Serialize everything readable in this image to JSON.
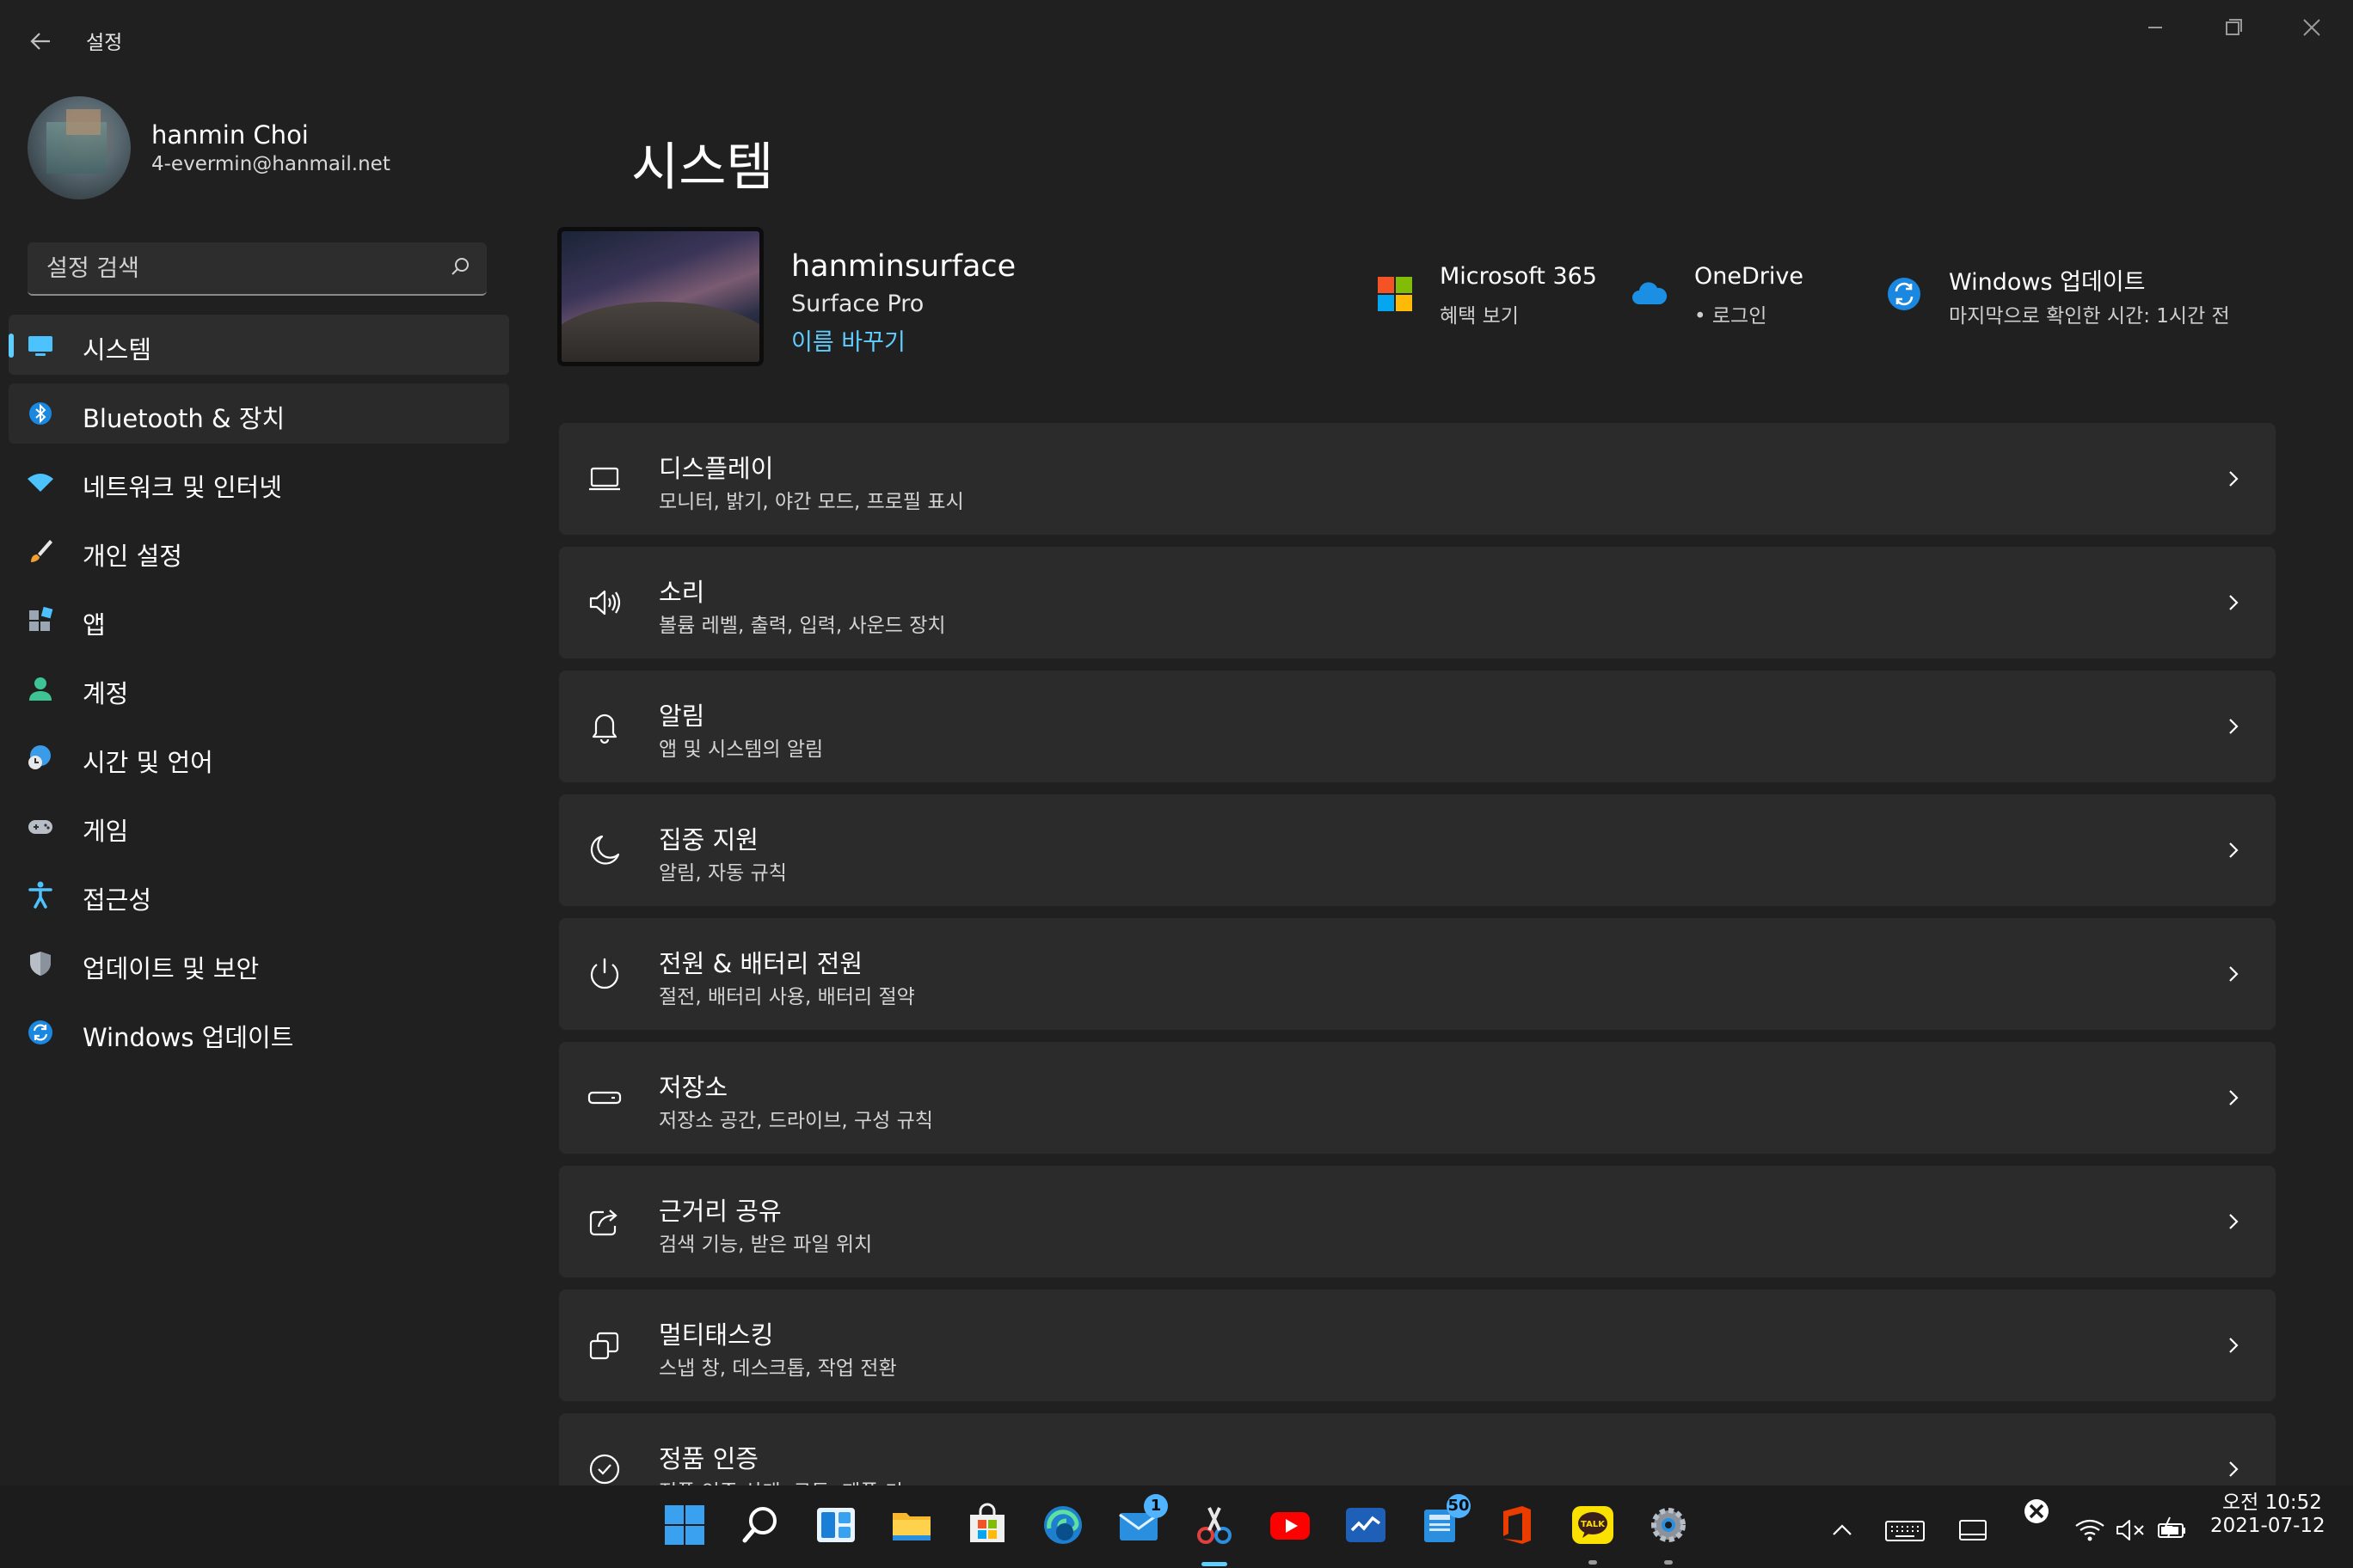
{
  "window": {
    "app_title": "설정",
    "back_icon": "back-arrow-icon",
    "controls": [
      "minimize-icon",
      "restore-icon",
      "close-icon"
    ]
  },
  "profile": {
    "name": "hanmin Choi",
    "email": "4-evermin@hanmail.net"
  },
  "search": {
    "placeholder": "설정 검색"
  },
  "sidebar": {
    "items": [
      {
        "label": "시스템",
        "icon": "monitor-icon",
        "active": true
      },
      {
        "label": "Bluetooth & 장치",
        "icon": "bluetooth-icon"
      },
      {
        "label": "네트워크 및 인터넷",
        "icon": "wifi-icon"
      },
      {
        "label": "개인 설정",
        "icon": "brush-icon"
      },
      {
        "label": "앱",
        "icon": "apps-icon"
      },
      {
        "label": "계정",
        "icon": "account-icon"
      },
      {
        "label": "시간 및 언어",
        "icon": "globe-clock-icon"
      },
      {
        "label": "게임",
        "icon": "gamepad-icon"
      },
      {
        "label": "접근성",
        "icon": "accessibility-icon"
      },
      {
        "label": "업데이트 및 보안",
        "icon": "shield-icon"
      },
      {
        "label": "Windows 업데이트",
        "icon": "windows-update-icon"
      }
    ]
  },
  "main": {
    "title": "시스템",
    "device": {
      "name": "hanminsurface",
      "model": "Surface Pro",
      "rename": "이름 바꾸기"
    },
    "quick": [
      {
        "title": "Microsoft 365",
        "sub": "혜택 보기",
        "icon": "microsoft-logo-icon"
      },
      {
        "title": "OneDrive",
        "sub": "• 로그인",
        "icon": "onedrive-cloud-icon"
      },
      {
        "title": "Windows 업데이트",
        "sub": "마지막으로 확인한 시간: 1시간 전",
        "icon": "windows-update-icon"
      }
    ],
    "cards": [
      {
        "title": "디스플레이",
        "sub": "모니터, 밝기, 야간 모드, 프로필 표시",
        "icon": "display-icon"
      },
      {
        "title": "소리",
        "sub": "볼륨 레벨, 출력, 입력, 사운드 장치",
        "icon": "speaker-icon"
      },
      {
        "title": "알림",
        "sub": "앱 및 시스템의 알림",
        "icon": "bell-icon"
      },
      {
        "title": "집중 지원",
        "sub": "알림, 자동 규칙",
        "icon": "moon-icon"
      },
      {
        "title": "전원 & 배터리 전원",
        "sub": "절전, 배터리 사용, 배터리 절약",
        "icon": "power-icon"
      },
      {
        "title": "저장소",
        "sub": "저장소 공간, 드라이브, 구성 규칙",
        "icon": "storage-icon"
      },
      {
        "title": "근거리 공유",
        "sub": "검색 기능, 받은 파일 위치",
        "icon": "share-icon"
      },
      {
        "title": "멀티태스킹",
        "sub": "스냅 창, 데스크톱, 작업 전환",
        "icon": "multitask-icon"
      },
      {
        "title": "정품 인증",
        "sub": "정품 인증 상태, 구독, 제품 키",
        "icon": "check-circle-icon"
      }
    ]
  },
  "taskbar": {
    "apps": [
      {
        "icon": "start-windows-icon"
      },
      {
        "icon": "search-icon"
      },
      {
        "icon": "widgets-icon"
      },
      {
        "icon": "file-explorer-icon"
      },
      {
        "icon": "store-icon"
      },
      {
        "icon": "edge-icon"
      },
      {
        "icon": "mail-icon",
        "badge": "1"
      },
      {
        "icon": "snip-tool-icon"
      },
      {
        "icon": "youtube-icon"
      },
      {
        "icon": "whiteboard-icon"
      },
      {
        "icon": "news-icon",
        "badge": "50"
      },
      {
        "icon": "office-icon"
      },
      {
        "icon": "kakaotalk-icon",
        "label": "TALK"
      },
      {
        "icon": "settings-gear-icon"
      }
    ],
    "tray": [
      "chevron-up-icon",
      "keyboard-icon",
      "tablet-icon",
      "xbox-icon",
      "wifi-icon",
      "volume-mute-icon",
      "battery-charging-icon"
    ],
    "time": "오전 10:52",
    "date": "2021-07-12"
  },
  "colors": {
    "accent": "#60cdff",
    "background": "#202020",
    "card": "#2b2b2b"
  }
}
